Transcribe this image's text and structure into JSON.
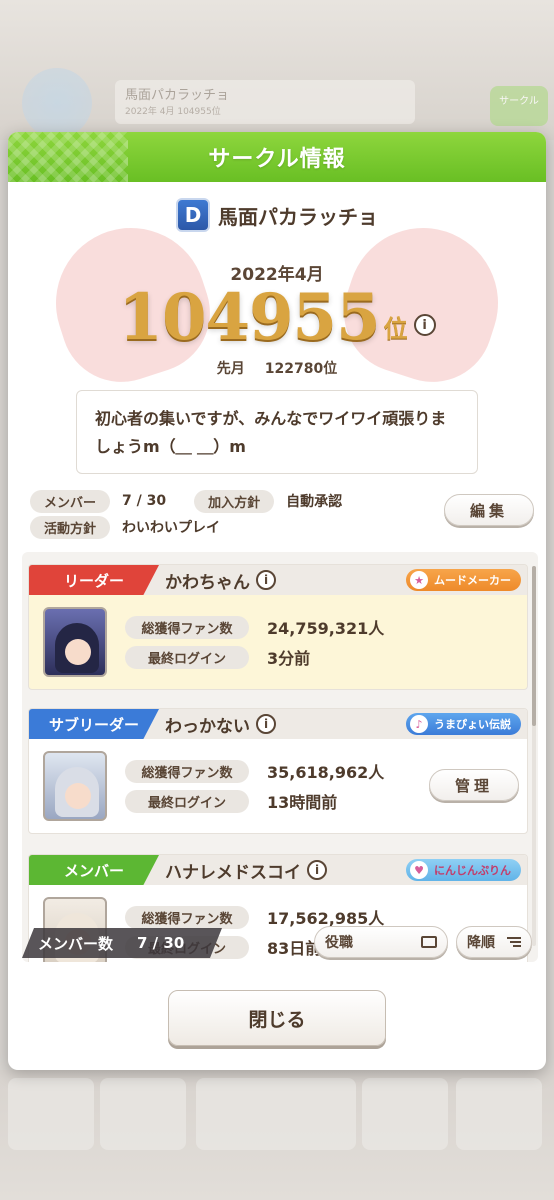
{
  "background": {
    "banner_title": "馬面パカラッチョ",
    "banner_sub": "2022年 4月 104955位",
    "right_button": "サークル",
    "tiles": [
      "",
      "",
      "",
      "",
      "",
      ""
    ]
  },
  "modal": {
    "title": "サークル情報"
  },
  "circle": {
    "emblem_letter": "D",
    "name": "馬面パカラッチョ",
    "month": "2022年4月",
    "rank": "104955",
    "rank_unit": "位",
    "prev_label": "先月",
    "prev_rank": "122780位",
    "description": "初心者の集いですが、みんなでワイワイ頑張りましょうm（＿ ＿）m"
  },
  "stats": {
    "members_label": "メンバー",
    "members_value": "7 / 30",
    "join_label": "加入方針",
    "join_value": "自動承認",
    "policy_label": "活動方針",
    "policy_value": "わいわいプレイ",
    "edit_label": "編集"
  },
  "members": [
    {
      "role": "リーダー",
      "name": "かわちゃん",
      "title": "ムードメーカー",
      "fans_label": "総獲得ファン数",
      "fans": "24,759,321人",
      "login_label": "最終ログイン",
      "login": "3分前"
    },
    {
      "role": "サブリーダー",
      "name": "わっかない",
      "title": "うまぴょい伝説",
      "fans_label": "総獲得ファン数",
      "fans": "35,618,962人",
      "login_label": "最終ログイン",
      "login": "13時間前",
      "manage_label": "管理"
    },
    {
      "role": "メンバー",
      "name": "ハナレメドスコイ",
      "title": "にんじんぷりん",
      "fans_label": "総獲得ファン数",
      "fans": "17,562,985人",
      "login_label": "最終ログイン",
      "login": "83日前"
    }
  ],
  "list_footer": {
    "count_label": "メンバー数",
    "count_value": "7 / 30",
    "sort_role": "役職",
    "sort_order": "降順"
  },
  "close_label": "閉じる"
}
